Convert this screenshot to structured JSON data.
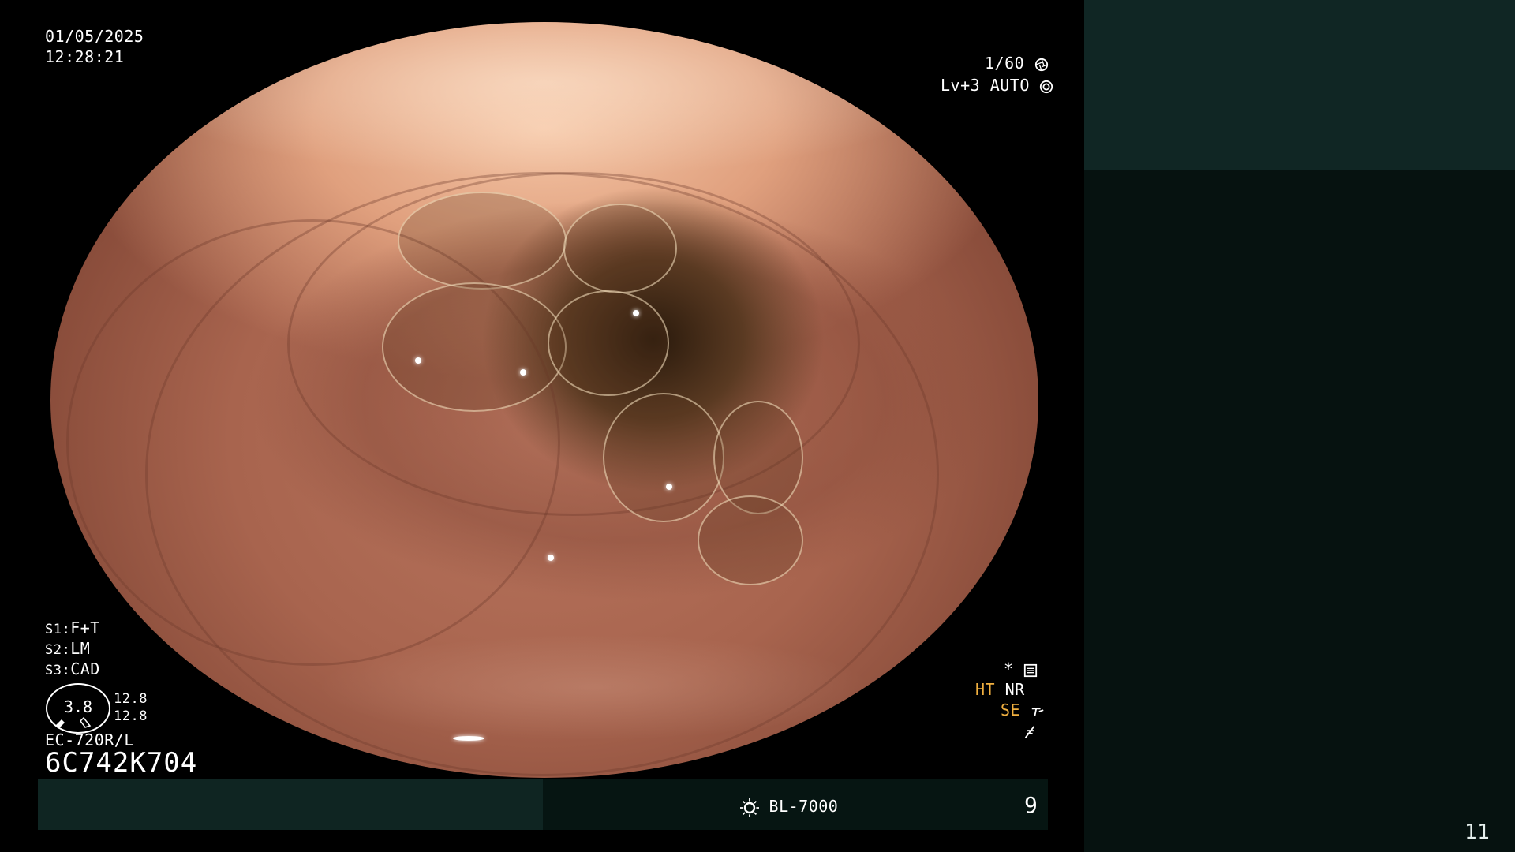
{
  "header": {
    "date": "01/05/2025",
    "time": "12:28:21",
    "shutter": "1/60",
    "level": "Lv+3",
    "iris": "AUTO"
  },
  "switches": {
    "s1_label": "S1:",
    "s1_value": "F+T",
    "s2_label": "S2:",
    "s2_value": "LM",
    "s3_label": "S3:",
    "s3_value": "CAD"
  },
  "gauge": {
    "value": "3.8",
    "top_right": "12.8",
    "bottom_right": "12.8"
  },
  "scope": {
    "model": "EC-720R/L",
    "serial": "6C742K704"
  },
  "modes": {
    "star": "*",
    "ht": "HT",
    "nr": "NR",
    "se": "SE"
  },
  "footer": {
    "light_source": "BL-7000",
    "frame_number": "9"
  },
  "slide_number": "11",
  "colors": {
    "accent_amber": "#f1b040",
    "panel_top": "#102624",
    "panel_bottom": "#061210",
    "bar_left": "#0f2522",
    "bar_right": "#061512"
  },
  "icons": [
    "shutter-icon",
    "iris-icon",
    "gear-menu-icon",
    "light-source-icon",
    "structure-enhance-icon",
    "focus-icon"
  ]
}
